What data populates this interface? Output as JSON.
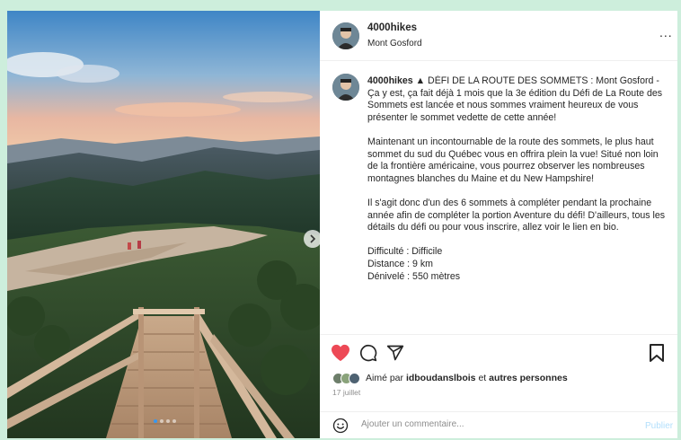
{
  "post": {
    "username": "4000hikes",
    "location": "Mont Gosford",
    "more_label": "...",
    "caption_username": "4000hikes",
    "caption_line1": "▲ DÉFI DE LA ROUTE DES SOMMETS : Mont Gosford - Ça y est, ça fait déjà 1 mois que la 3e édition du Défi de La Route des Sommets est lancée et nous sommes vraiment heureux de vous présenter le sommet vedette de cette année!",
    "caption_p2": "Maintenant un incontournable de la route des sommets, le plus haut sommet du sud du Québec vous en offrira plein la vue! Situé non loin de la frontière américaine, vous pourrez observer les nombreuses montagnes blanches du Maine et du New Hampshire!",
    "caption_p3": "Il s'agit donc d'un des 6 sommets à compléter pendant la prochaine année afin de compléter la portion Aventure du défi! D'ailleurs, tous les détails du défi ou pour vous inscrire, allez voir le lien en bio.",
    "difficulty": "Difficulté : Difficile",
    "distance": "Distance : 9 km",
    "elevation": "Dénivelé : 550 mètres"
  },
  "likes": {
    "prefix": "Aimé par",
    "user": "idboudanslbois",
    "joiner": "et",
    "others": "autres personnes"
  },
  "date": "17 juillet",
  "comment": {
    "placeholder": "Ajouter un commentaire...",
    "publish_label": "Publier"
  },
  "icons": {
    "like": "heart-filled-icon",
    "comment": "comment-bubble-icon",
    "share": "paper-plane-icon",
    "save": "bookmark-icon",
    "emoji": "smiley-icon",
    "next": "chevron-right-icon"
  },
  "colors": {
    "like": "#ed4956",
    "publish": "#b2dffc",
    "carousel_active": "#3897f0",
    "background": "#cdeedc"
  },
  "carousel": {
    "slides": 4,
    "active": 1
  }
}
